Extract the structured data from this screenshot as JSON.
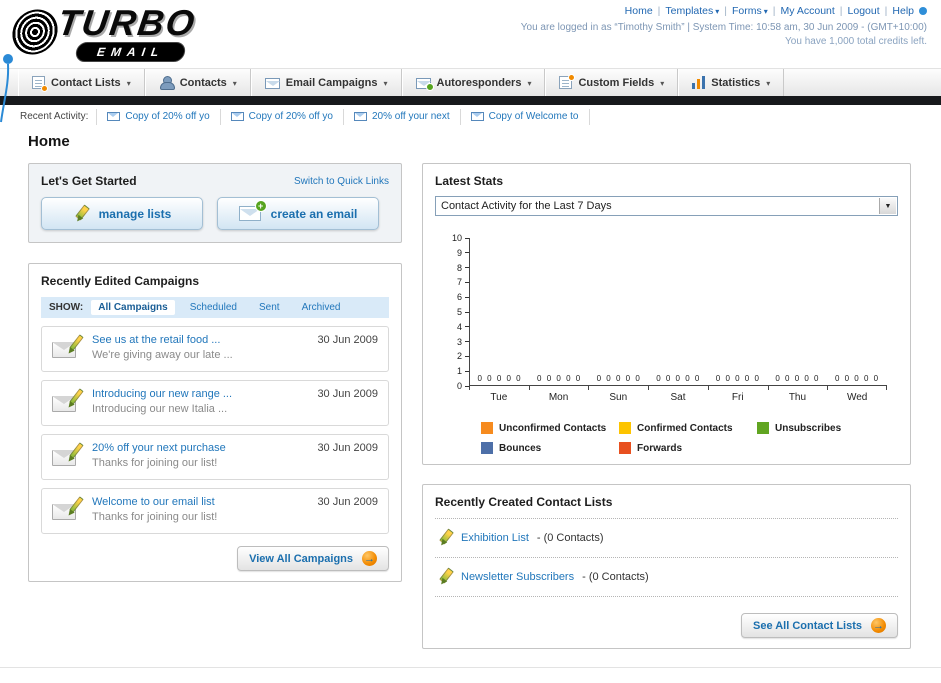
{
  "header": {
    "logo_main": "TURBO",
    "logo_sub": "EMAIL",
    "nav_links": [
      "Home",
      "Templates",
      "Forms",
      "My Account",
      "Logout",
      "Help"
    ],
    "login_line": "You are logged in as “Timothy Smith” | System Time: 10:58 am, 30 Jun 2009 - (GMT+10:00)",
    "credits_line": "You have 1,000 total credits left."
  },
  "tabs": [
    {
      "label": "Contact Lists"
    },
    {
      "label": "Contacts"
    },
    {
      "label": "Email Campaigns"
    },
    {
      "label": "Autoresponders"
    },
    {
      "label": "Custom Fields"
    },
    {
      "label": "Statistics"
    }
  ],
  "activity": {
    "label": "Recent Activity:",
    "items": [
      "Copy of 20% off yo",
      "Copy of 20% off yo",
      "20% off your next",
      "Copy of Welcome to"
    ]
  },
  "page_title": "Home",
  "get_started": {
    "title": "Let's Get Started",
    "switch_link": "Switch to Quick Links",
    "manage_lists_label": "manage lists",
    "create_email_label": "create an email"
  },
  "campaigns": {
    "title": "Recently Edited Campaigns",
    "show_label": "SHOW:",
    "filters": [
      "All Campaigns",
      "Scheduled",
      "Sent",
      "Archived"
    ],
    "items": [
      {
        "title": "See us at the retail food ...",
        "subtitle": "We're giving away our late ...",
        "date": "30 Jun 2009"
      },
      {
        "title": "Introducing our new range ...",
        "subtitle": "Introducing our new Italia ...",
        "date": "30 Jun 2009"
      },
      {
        "title": "20% off your next purchase",
        "subtitle": "Thanks for joining our list!",
        "date": "30 Jun 2009"
      },
      {
        "title": "Welcome to our email list",
        "subtitle": "Thanks for joining our list!",
        "date": "30 Jun 2009"
      }
    ],
    "view_all_label": "View All Campaigns"
  },
  "stats": {
    "title": "Latest Stats",
    "dropdown_value": "Contact Activity for the Last 7 Days",
    "chart_data": {
      "type": "bar",
      "title": "Contact Activity for the Last 7 Days",
      "categories": [
        "Tue",
        "Mon",
        "Sun",
        "Sat",
        "Fri",
        "Thu",
        "Wed"
      ],
      "series": [
        {
          "name": "Unconfirmed Contacts",
          "color": "#f68b1f",
          "values": [
            0,
            0,
            0,
            0,
            0,
            0,
            0
          ]
        },
        {
          "name": "Confirmed Contacts",
          "color": "#fdc400",
          "values": [
            0,
            0,
            0,
            0,
            0,
            0,
            0
          ]
        },
        {
          "name": "Unsubscribes",
          "color": "#61a521",
          "values": [
            0,
            0,
            0,
            0,
            0,
            0,
            0
          ]
        },
        {
          "name": "Bounces",
          "color": "#4d6fa8",
          "values": [
            0,
            0,
            0,
            0,
            0,
            0,
            0
          ]
        },
        {
          "name": "Forwards",
          "color": "#e8501f",
          "values": [
            0,
            0,
            0,
            0,
            0,
            0,
            0
          ]
        }
      ],
      "ylim": [
        0,
        10
      ],
      "yticks": [
        0,
        1,
        2,
        3,
        4,
        5,
        6,
        7,
        8,
        9,
        10
      ],
      "xlabel": "",
      "ylabel": "",
      "grid": false,
      "legend_position": "bottom"
    }
  },
  "contact_lists": {
    "title": "Recently Created Contact Lists",
    "items": [
      {
        "name": "Exhibition List",
        "detail": "- (0 Contacts)"
      },
      {
        "name": "Newsletter Subscribers",
        "detail": "- (0 Contacts)"
      }
    ],
    "see_all_label": "See All Contact Lists"
  }
}
